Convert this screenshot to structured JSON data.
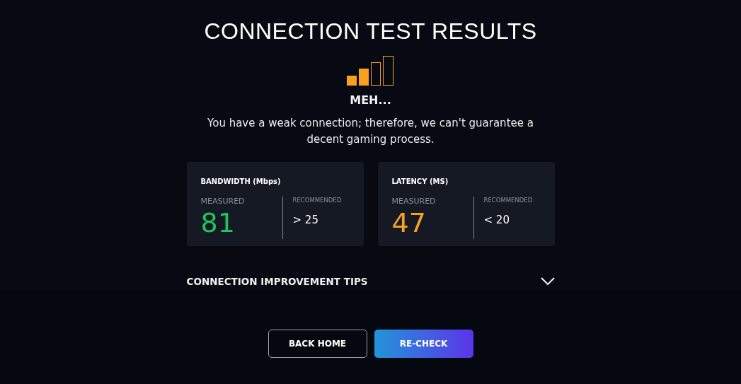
{
  "title": "CONNECTION TEST RESULTS",
  "verdict": "MEH...",
  "message": "You have a weak connection; therefore, we can't guarantee a decent gaming process.",
  "metrics": [
    {
      "title": "BANDWIDTH (Mbps)",
      "measured_label": "MEASURED",
      "value": "81",
      "color": "#1fc45a",
      "recommended_label": "RECOMMENDED",
      "recommended": "> 25"
    },
    {
      "title": "LATENCY (MS)",
      "measured_label": "MEASURED",
      "value": "47",
      "color": "#f7a11f",
      "recommended_label": "RECOMMENDED",
      "recommended": "< 20"
    }
  ],
  "tips": {
    "label": "CONNECTION IMPROVEMENT TIPS",
    "expanded": false
  },
  "buttons": [
    {
      "label": "BACK HOME",
      "kind": "outline"
    },
    {
      "label": "RE-CHECK",
      "kind": "primary"
    }
  ]
}
